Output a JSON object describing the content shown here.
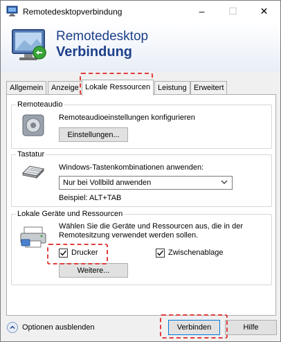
{
  "window": {
    "title": "Remotedesktopverbindung",
    "controls": {
      "minimize": "–",
      "maximize": "☐",
      "close": "✕"
    }
  },
  "banner": {
    "line1": "Remotedesktop",
    "line2": "Verbindung"
  },
  "tabs": [
    {
      "label": "Allgemein"
    },
    {
      "label": "Anzeige"
    },
    {
      "label": "Lokale Ressourcen",
      "active": true
    },
    {
      "label": "Leistung"
    },
    {
      "label": "Erweitert"
    }
  ],
  "remoteaudio": {
    "title": "Remoteaudio",
    "description": "Remoteaudioeinstellungen konfigurieren",
    "button": "Einstellungen..."
  },
  "tastatur": {
    "title": "Tastatur",
    "description": "Windows-Tastenkombinationen anwenden:",
    "selected": "Nur bei Vollbild anwenden",
    "example": "Beispiel: ALT+TAB"
  },
  "geraete": {
    "title": "Lokale Geräte und Ressourcen",
    "description_line1": "Wählen Sie die Geräte und Ressourcen aus, die in der",
    "description_line2": "Remotesitzung verwendet werden sollen.",
    "drucker": {
      "label": "Drucker",
      "checked": true
    },
    "zwischenablage": {
      "label": "Zwischenablage",
      "checked": true
    },
    "more_button": "Weitere..."
  },
  "footer": {
    "options_label": "Optionen ausblenden",
    "connect_button": "Verbinden",
    "help_button": "Hilfe"
  },
  "colors": {
    "accent": "#0078d7",
    "brand": "#1c3f8a",
    "highlight": "#e23b3b"
  }
}
